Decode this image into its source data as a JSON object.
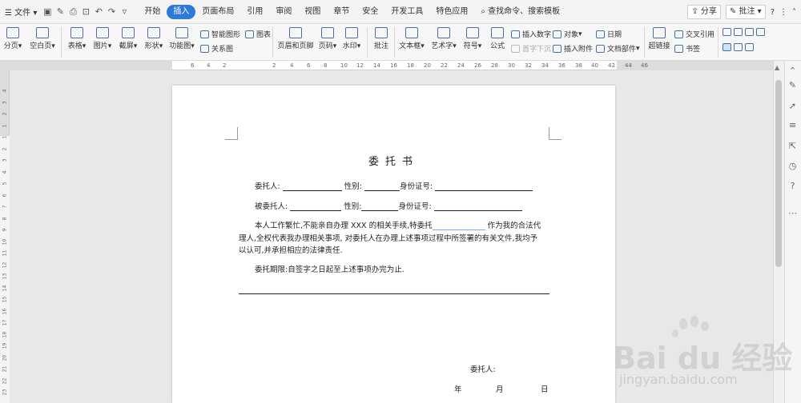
{
  "menubar": {
    "file_label": "文件",
    "tabs": [
      "开始",
      "插入",
      "页面布局",
      "引用",
      "审阅",
      "视图",
      "章节",
      "安全",
      "开发工具",
      "特色应用"
    ],
    "active_tab": "插入",
    "search_label": "查找命令、搜索模板",
    "share_label": "分享",
    "comment_label": "批注",
    "help_label": "?"
  },
  "ribbon": {
    "page_break": "分页",
    "blank_page": "空白页",
    "table": "表格",
    "picture": "图片",
    "screenshot": "截屏",
    "shape": "形状",
    "func_chart": "功能图",
    "smart_shape": "智能图形",
    "chart": "图表",
    "relation": "关系图",
    "header_footer": "页眉和页脚",
    "page_num": "页码",
    "watermark": "水印",
    "comment": "批注",
    "textbox": "文本框",
    "wordart": "艺术字",
    "symbol": "符号",
    "formula": "公式",
    "insert_number": "插入数字",
    "object": "对象",
    "date": "日期",
    "drop_cap": "首字下沉",
    "attachment": "插入附件",
    "doc_parts": "文档部件",
    "hyperlink": "超链接",
    "cross_ref": "交叉引用",
    "bookmark": "书签"
  },
  "ruler": {
    "h_ticks": [
      "6",
      "4",
      "2",
      "2",
      "4",
      "6",
      "8",
      "10",
      "12",
      "14",
      "16",
      "18",
      "20",
      "22",
      "24",
      "26",
      "28",
      "30",
      "32",
      "34",
      "36",
      "38",
      "40",
      "42",
      "44",
      "46"
    ],
    "v_ticks": [
      "4",
      "3",
      "2",
      "1",
      "1",
      "2",
      "3",
      "4",
      "5",
      "6",
      "7",
      "8",
      "9",
      "10",
      "11",
      "12",
      "13",
      "14",
      "15",
      "16",
      "17",
      "18",
      "19",
      "20",
      "21",
      "22",
      "23"
    ]
  },
  "document": {
    "title": "委托书",
    "line1_label1": "委托人:",
    "line1_label2": "性别:",
    "line1_label3": "身份证号:",
    "line2_label1": "被委托人:",
    "line2_label2": "性别:",
    "line2_label3": "身份证号:",
    "para_line1_a": "本人工作繁忙,不能亲自办理 XXX 的相关手续,特委托",
    "para_line1_b": "作为我的合法代",
    "para_line2": "理人,全权代表我办理相关事项, 对委托人在办理上述事项过程中所签署的有关文件,我均予",
    "para_line3": "以认可,并承担相应的法律责任.",
    "period": "委托期限:自签字之日起至上述事项办完为止.",
    "sign_label": "委托人:",
    "date_year": "年",
    "date_month": "月",
    "date_day": "日"
  },
  "watermark_overlay": {
    "logo_text": "Bai du 经验",
    "url": "jingyan.baidu.com"
  }
}
